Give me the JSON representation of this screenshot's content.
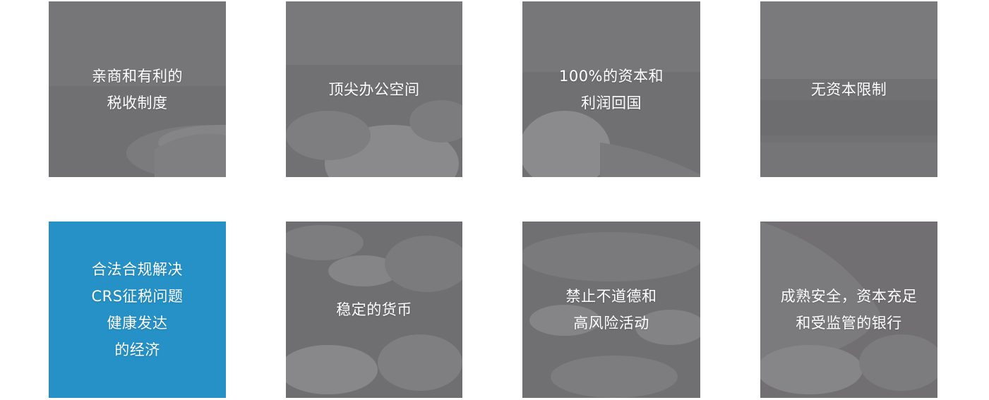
{
  "colors": {
    "tile_overlay": "#6e6c6f",
    "tile_active": "#2591c6",
    "label_text": "#ffffff"
  },
  "tiles": [
    {
      "lines": [
        "亲商和有利的",
        "税收制度"
      ],
      "active": false
    },
    {
      "lines": [
        "顶尖办公空间"
      ],
      "active": false
    },
    {
      "lines": [
        "100%的资本和",
        "利润回国"
      ],
      "active": false
    },
    {
      "lines": [
        "无资本限制"
      ],
      "active": false
    },
    {
      "lines": [
        "合法合规解决",
        "CRS征税问题",
        "健康发达",
        "的经济"
      ],
      "active": true
    },
    {
      "lines": [
        "稳定的货币"
      ],
      "active": false
    },
    {
      "lines": [
        "禁止不道德和",
        "高风险活动"
      ],
      "active": false
    },
    {
      "lines": [
        "成熟安全，资本充足",
        "和受监管的银行"
      ],
      "active": false
    }
  ]
}
